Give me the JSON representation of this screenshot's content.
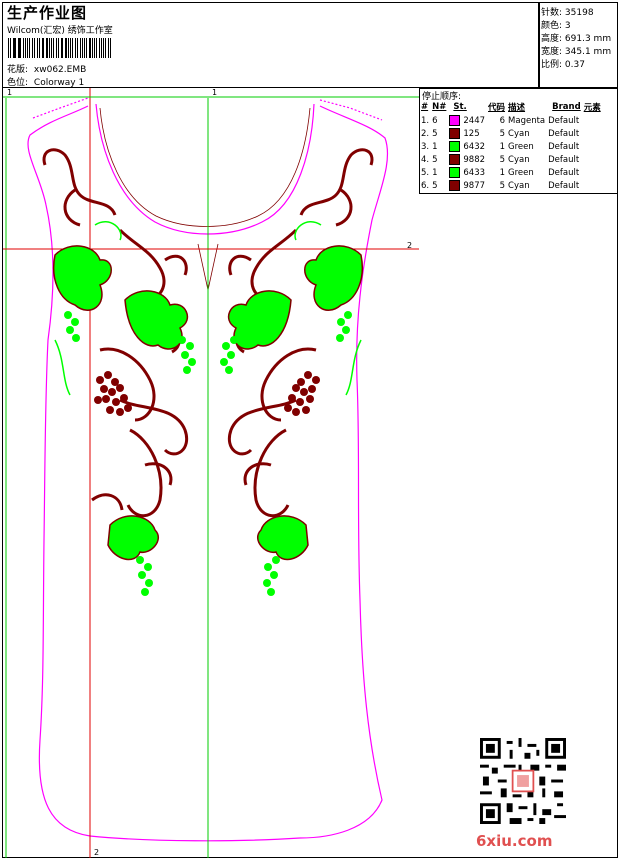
{
  "header": {
    "title": "生产作业图",
    "company": "Wilcom(汇宏) 绣饰工作室",
    "design_label": "花版:",
    "design_name": "xw062.EMB",
    "colorway_label": "色位:",
    "colorway_name": "Colorway 1"
  },
  "stats": [
    {
      "label": "针数",
      "value": "35198"
    },
    {
      "label": "颜色",
      "value": "3"
    },
    {
      "label": "高度",
      "value": "691.3 mm"
    },
    {
      "label": "宽度",
      "value": "345.1 mm"
    },
    {
      "label": "比例",
      "value": "0.37"
    }
  ],
  "stop_sequence": {
    "title": "停止顺序:",
    "headers": [
      "#",
      "N#",
      "St.",
      "代码",
      "描述",
      "Brand",
      "元素"
    ],
    "rows": [
      {
        "num": "1.",
        "n": "6",
        "code": "2447",
        "desc_num": "6",
        "desc": "Magenta",
        "brand": "Default",
        "color": "#ff00ff"
      },
      {
        "num": "2.",
        "n": "5",
        "code": "125",
        "desc_num": "5",
        "desc": "Cyan",
        "brand": "Default",
        "color": "#800000"
      },
      {
        "num": "3.",
        "n": "1",
        "code": "6432",
        "desc_num": "1",
        "desc": "Green",
        "brand": "Default",
        "color": "#00ff00"
      },
      {
        "num": "4.",
        "n": "5",
        "code": "9882",
        "desc_num": "5",
        "desc": "Cyan",
        "brand": "Default",
        "color": "#800000"
      },
      {
        "num": "5.",
        "n": "1",
        "code": "6433",
        "desc_num": "1",
        "desc": "Green",
        "brand": "Default",
        "color": "#00ff00"
      },
      {
        "num": "6.",
        "n": "5",
        "code": "9877",
        "desc_num": "5",
        "desc": "Cyan",
        "brand": "Default",
        "color": "#800000"
      }
    ]
  },
  "guides": {
    "v1": "1",
    "v2": "1",
    "h": "2",
    "bottom": "2"
  },
  "watermark": "6xiu.com",
  "colors": {
    "magenta": "#ff00ff",
    "maroon": "#800000",
    "green": "#00ff00",
    "guide_red": "#e00000",
    "guide_green": "#00cc00"
  }
}
